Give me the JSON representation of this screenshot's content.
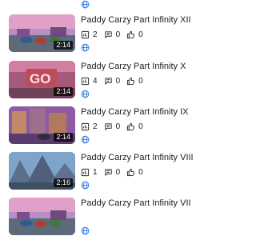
{
  "videos": [
    {
      "title": "",
      "duration": "",
      "views": "",
      "comments": "",
      "likes": "",
      "visibility_icon": "globe-icon",
      "thumb_scene": "purple"
    },
    {
      "title": "Paddy Carzy Part Infinity XII",
      "duration": "2:14",
      "views": "2",
      "comments": "0",
      "likes": "0",
      "visibility_icon": "globe-icon",
      "thumb_scene": "race"
    },
    {
      "title": "Paddy Carzy Part Infinity X",
      "duration": "2:14",
      "views": "4",
      "comments": "0",
      "likes": "0",
      "visibility_icon": "globe-icon",
      "thumb_scene": "go-sign"
    },
    {
      "title": "Paddy Carzy Part Infinity IX",
      "duration": "2:14",
      "views": "2",
      "comments": "0",
      "likes": "0",
      "visibility_icon": "globe-icon",
      "thumb_scene": "town"
    },
    {
      "title": "Paddy Carzy Part Infinity VIII",
      "duration": "2:16",
      "views": "1",
      "comments": "0",
      "likes": "0",
      "visibility_icon": "globe-icon",
      "thumb_scene": "mountains"
    },
    {
      "title": "Paddy Carzy Part Infinity VII",
      "duration": "",
      "views": "",
      "comments": "",
      "likes": "",
      "visibility_icon": "globe-icon",
      "thumb_scene": "race"
    }
  ],
  "icons": {
    "views": "bar-chart-icon",
    "comments": "comment-icon",
    "likes": "thumbs-up-icon"
  }
}
